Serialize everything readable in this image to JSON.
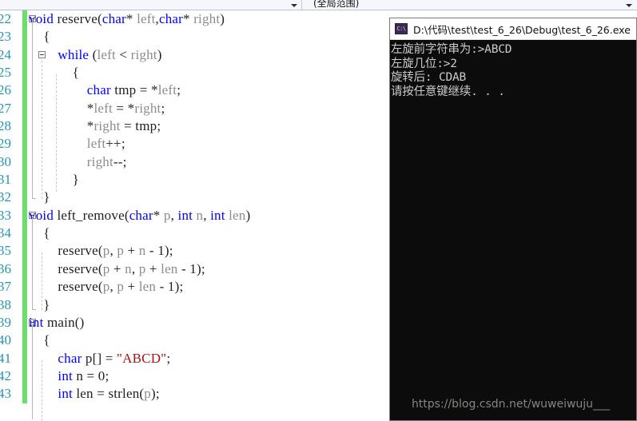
{
  "nav_bar": {
    "left_dropdown_value": "",
    "scope_dropdown_value": "(全局范围)",
    "caret_icon": "chevron-down-icon"
  },
  "editor": {
    "first_line_number": 22,
    "lines": [
      {
        "num": "22",
        "indent": 0,
        "fold": 1,
        "changed": true,
        "tokens": [
          {
            "t": "void",
            "c": "kw"
          },
          {
            "t": " reserve",
            "c": "pl"
          },
          {
            "t": "(",
            "c": "pl"
          },
          {
            "t": "char",
            "c": "kw"
          },
          {
            "t": "* ",
            "c": "pl"
          },
          {
            "t": "left",
            "c": "id"
          },
          {
            "t": ",",
            "c": "pl"
          },
          {
            "t": "char",
            "c": "kw"
          },
          {
            "t": "* ",
            "c": "pl"
          },
          {
            "t": "right",
            "c": "id"
          },
          {
            "t": ")",
            "c": "pl"
          }
        ]
      },
      {
        "num": "23",
        "indent": 1,
        "fold": 0,
        "changed": true,
        "tokens": [
          {
            "t": "{",
            "c": "pl"
          }
        ]
      },
      {
        "num": "24",
        "indent": 2,
        "fold": 2,
        "changed": true,
        "tokens": [
          {
            "t": "while",
            "c": "kw"
          },
          {
            "t": " (",
            "c": "pl"
          },
          {
            "t": "left",
            "c": "id"
          },
          {
            "t": " < ",
            "c": "pl"
          },
          {
            "t": "right",
            "c": "id"
          },
          {
            "t": ")",
            "c": "pl"
          }
        ]
      },
      {
        "num": "25",
        "indent": 3,
        "fold": 0,
        "changed": true,
        "tokens": [
          {
            "t": "{",
            "c": "pl"
          }
        ]
      },
      {
        "num": "26",
        "indent": 4,
        "fold": 0,
        "changed": true,
        "tokens": [
          {
            "t": "char",
            "c": "kw"
          },
          {
            "t": " tmp = *",
            "c": "pl"
          },
          {
            "t": "left",
            "c": "id"
          },
          {
            "t": ";",
            "c": "pl"
          }
        ]
      },
      {
        "num": "27",
        "indent": 4,
        "fold": 0,
        "changed": true,
        "tokens": [
          {
            "t": "*",
            "c": "pl"
          },
          {
            "t": "left",
            "c": "id"
          },
          {
            "t": " = *",
            "c": "pl"
          },
          {
            "t": "right",
            "c": "id"
          },
          {
            "t": ";",
            "c": "pl"
          }
        ]
      },
      {
        "num": "28",
        "indent": 4,
        "fold": 0,
        "changed": true,
        "tokens": [
          {
            "t": "*",
            "c": "pl"
          },
          {
            "t": "right",
            "c": "id"
          },
          {
            "t": " = tmp;",
            "c": "pl"
          }
        ]
      },
      {
        "num": "29",
        "indent": 4,
        "fold": 0,
        "changed": true,
        "tokens": [
          {
            "t": "left",
            "c": "id"
          },
          {
            "t": "++;",
            "c": "pl"
          }
        ]
      },
      {
        "num": "30",
        "indent": 4,
        "fold": 0,
        "changed": true,
        "tokens": [
          {
            "t": "right",
            "c": "id"
          },
          {
            "t": "--;",
            "c": "pl"
          }
        ]
      },
      {
        "num": "31",
        "indent": 3,
        "fold": 0,
        "changed": true,
        "tokens": [
          {
            "t": "}",
            "c": "pl"
          }
        ]
      },
      {
        "num": "32",
        "indent": 1,
        "fold": 0,
        "changed": true,
        "tokens": [
          {
            "t": "}",
            "c": "pl"
          }
        ]
      },
      {
        "num": "33",
        "indent": 0,
        "fold": 1,
        "changed": true,
        "tokens": [
          {
            "t": "void",
            "c": "kw"
          },
          {
            "t": " left_remove",
            "c": "pl"
          },
          {
            "t": "(",
            "c": "pl"
          },
          {
            "t": "char",
            "c": "kw"
          },
          {
            "t": "* ",
            "c": "pl"
          },
          {
            "t": "p",
            "c": "id"
          },
          {
            "t": ", ",
            "c": "pl"
          },
          {
            "t": "int",
            "c": "kw"
          },
          {
            "t": " ",
            "c": "pl"
          },
          {
            "t": "n",
            "c": "id"
          },
          {
            "t": ", ",
            "c": "pl"
          },
          {
            "t": "int",
            "c": "kw"
          },
          {
            "t": " ",
            "c": "pl"
          },
          {
            "t": "len",
            "c": "id"
          },
          {
            "t": ")",
            "c": "pl"
          }
        ]
      },
      {
        "num": "34",
        "indent": 1,
        "fold": 0,
        "changed": true,
        "tokens": [
          {
            "t": "{",
            "c": "pl"
          }
        ]
      },
      {
        "num": "35",
        "indent": 2,
        "fold": 0,
        "changed": true,
        "tokens": [
          {
            "t": "reserve",
            "c": "pl"
          },
          {
            "t": "(",
            "c": "pl"
          },
          {
            "t": "p",
            "c": "id"
          },
          {
            "t": ", ",
            "c": "pl"
          },
          {
            "t": "p",
            "c": "id"
          },
          {
            "t": " + ",
            "c": "pl"
          },
          {
            "t": "n",
            "c": "id"
          },
          {
            "t": " - ",
            "c": "pl"
          },
          {
            "t": "1",
            "c": "num"
          },
          {
            "t": ");",
            "c": "pl"
          }
        ]
      },
      {
        "num": "36",
        "indent": 2,
        "fold": 0,
        "changed": true,
        "tokens": [
          {
            "t": "reserve",
            "c": "pl"
          },
          {
            "t": "(",
            "c": "pl"
          },
          {
            "t": "p",
            "c": "id"
          },
          {
            "t": " + ",
            "c": "pl"
          },
          {
            "t": "n",
            "c": "id"
          },
          {
            "t": ", ",
            "c": "pl"
          },
          {
            "t": "p",
            "c": "id"
          },
          {
            "t": " + ",
            "c": "pl"
          },
          {
            "t": "len",
            "c": "id"
          },
          {
            "t": " - ",
            "c": "pl"
          },
          {
            "t": "1",
            "c": "num"
          },
          {
            "t": ");",
            "c": "pl"
          }
        ]
      },
      {
        "num": "37",
        "indent": 2,
        "fold": 0,
        "changed": true,
        "tokens": [
          {
            "t": "reserve",
            "c": "pl"
          },
          {
            "t": "(",
            "c": "pl"
          },
          {
            "t": "p",
            "c": "id"
          },
          {
            "t": ", ",
            "c": "pl"
          },
          {
            "t": "p",
            "c": "id"
          },
          {
            "t": " + ",
            "c": "pl"
          },
          {
            "t": "len",
            "c": "id"
          },
          {
            "t": " - ",
            "c": "pl"
          },
          {
            "t": "1",
            "c": "num"
          },
          {
            "t": ");",
            "c": "pl"
          }
        ]
      },
      {
        "num": "38",
        "indent": 1,
        "fold": 0,
        "changed": true,
        "tokens": [
          {
            "t": "}",
            "c": "pl"
          }
        ]
      },
      {
        "num": "39",
        "indent": 0,
        "fold": 1,
        "changed": true,
        "tokens": [
          {
            "t": "int",
            "c": "kw"
          },
          {
            "t": " main()",
            "c": "pl"
          }
        ]
      },
      {
        "num": "40",
        "indent": 1,
        "fold": 0,
        "changed": true,
        "tokens": [
          {
            "t": "{",
            "c": "pl"
          }
        ]
      },
      {
        "num": "41",
        "indent": 2,
        "fold": 0,
        "changed": true,
        "tokens": [
          {
            "t": "char",
            "c": "kw"
          },
          {
            "t": " p[] = ",
            "c": "pl"
          },
          {
            "t": "\"ABCD\"",
            "c": "str"
          },
          {
            "t": ";",
            "c": "pl"
          }
        ]
      },
      {
        "num": "42",
        "indent": 2,
        "fold": 0,
        "changed": true,
        "tokens": [
          {
            "t": "int",
            "c": "kw"
          },
          {
            "t": " n = ",
            "c": "pl"
          },
          {
            "t": "0",
            "c": "num"
          },
          {
            "t": ";",
            "c": "pl"
          }
        ]
      },
      {
        "num": "43",
        "indent": 2,
        "fold": 0,
        "changed": true,
        "tokens": [
          {
            "t": "int",
            "c": "kw"
          },
          {
            "t": " len = strlen(",
            "c": "pl"
          },
          {
            "t": "p",
            "c": "id"
          },
          {
            "t": ");",
            "c": "pl"
          }
        ]
      }
    ]
  },
  "console": {
    "icon": "console-window-icon",
    "icon_glyph": "C:\\",
    "title": "D:\\代码\\test\\test_6_26\\Debug\\test_6_26.exe",
    "output_lines": [
      "左旋前字符串为:>ABCD",
      "左旋几位:>2",
      "旋转后: CDAB",
      "请按任意键继续. . ."
    ],
    "watermark": "https://blog.csdn.net/wuweiwuju___"
  },
  "colors": {
    "keyword": "#0000ff",
    "identifier": "#8c8c8c",
    "string": "#a31515",
    "line_number": "#2b91af",
    "change_bar": "#6fdc6f",
    "console_bg": "#0c0c0c",
    "console_text": "#cccccc"
  }
}
